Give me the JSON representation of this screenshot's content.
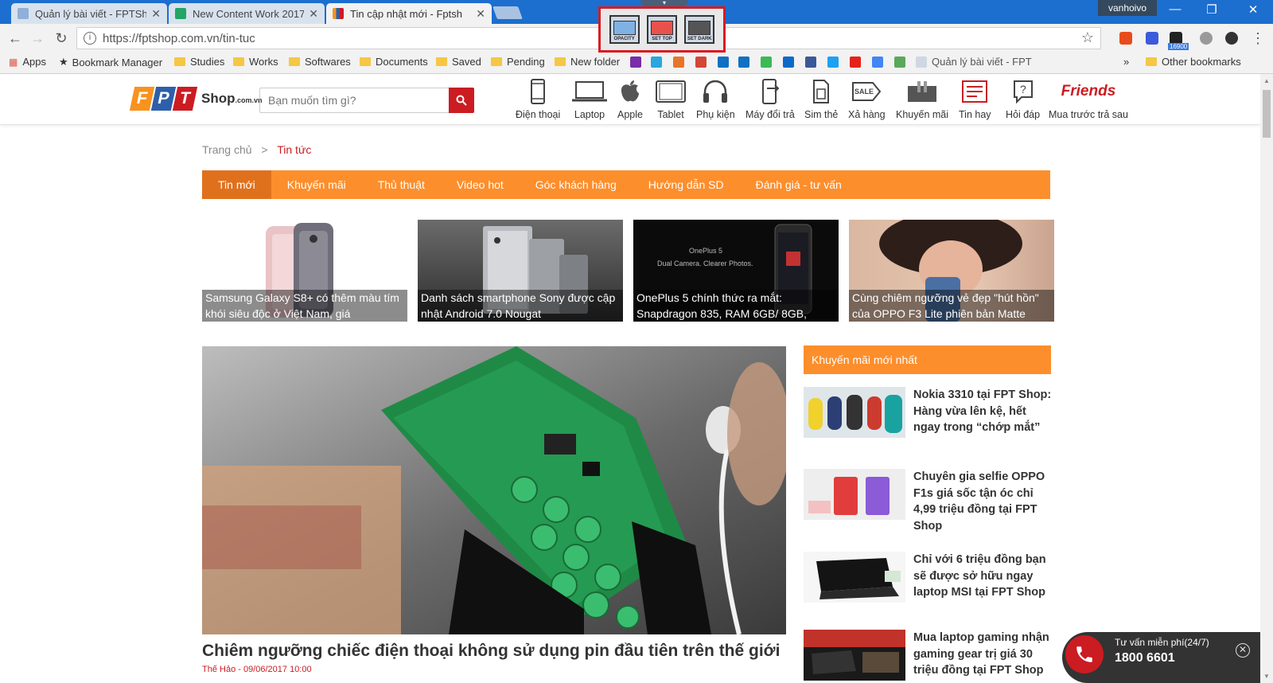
{
  "browser": {
    "tabs": [
      {
        "title": "Quản lý bài viết - FPTSho"
      },
      {
        "title": "New Content Work 2017"
      },
      {
        "title": "Tin cập nhật mới - Fptsh"
      }
    ],
    "user": "vanhoivo",
    "url": "https://fptshop.com.vn/tin-tuc",
    "extension_buttons": [
      "OPACITY",
      "SET TOP",
      "SET DARK"
    ],
    "extension_badge": "16900",
    "bookmarks": [
      "Apps",
      "Bookmark Manager",
      "Studies",
      "Works",
      "Softwares",
      "Documents",
      "Saved",
      "Pending",
      "New folder"
    ],
    "bookmark_page": "Quản lý bài viết - FPT",
    "other_bookmarks": "Other bookmarks",
    "overflow": "»"
  },
  "site": {
    "logo_letters": [
      "F",
      "P",
      "T"
    ],
    "logo_shop": "Shop",
    "logo_domain": ".com.vn",
    "search_placeholder": "Bạn muốn tìm gì?",
    "categories": [
      "Điện thoại",
      "Laptop",
      "Apple",
      "Tablet",
      "Phụ kiện",
      "Máy đổi trả",
      "Sim thẻ",
      "Xả hàng",
      "Khuyến mãi",
      "Tin hay",
      "Hỏi đáp",
      "Mua trước trả sau"
    ],
    "friends_logo": "Friends",
    "sale_label": "SALE",
    "breadcrumb": {
      "home": "Trang chủ",
      "sep": ">",
      "current": "Tin tức"
    },
    "nav": [
      "Tin mới",
      "Khuyến mãi",
      "Thủ thuật",
      "Video hot",
      "Góc khách hàng",
      "Hướng dẫn SD",
      "Đánh giá - tư vấn"
    ],
    "featured": [
      {
        "title": "Samsung Galaxy S8+ có thêm màu tím khói siêu độc ở Việt Nam, giá"
      },
      {
        "title": "Danh sách smartphone Sony được cập nhật Android 7.0 Nougat"
      },
      {
        "title": "OnePlus 5 chính thức ra mắt: Snapdragon 835, RAM 6GB/ 8GB,"
      },
      {
        "title": "Cùng chiêm ngưỡng vẻ đẹp \"hút hồn\" của OPPO F3 Lite phiên bản Matte"
      }
    ],
    "oneplus_promo": [
      "OnePlus 5",
      "Dual Camera. Clearer Photos."
    ],
    "hero": {
      "title": "Chiêm ngưỡng chiếc điện thoại không sử dụng pin đầu tiên trên thế giới",
      "meta": "Thế Hảo - 09/06/2017 10:00"
    },
    "sidebar": {
      "heading": "Khuyến mãi mới nhất",
      "items": [
        {
          "title": "Nokia 3310 tại FPT Shop: Hàng vừa lên kệ, hết ngay trong “chớp mắt”"
        },
        {
          "title": "Chuyên gia selfie OPPO F1s giá sốc tận óc chỉ 4,99 triệu đồng tại FPT Shop"
        },
        {
          "title": "Chỉ với 6 triệu đồng bạn sẽ được sở hữu ngay laptop MSI tại FPT Shop"
        },
        {
          "title": "Mua laptop gaming nhận gaming gear trị giá 30 triệu đồng tại FPT Shop"
        }
      ]
    },
    "hotline": {
      "label": "Tư vấn miễn phí(24/7)",
      "number": "1800 6601"
    }
  },
  "colors": {
    "brand_red": "#cb1c22",
    "nav_orange": "#fd8e2c",
    "nav_active": "#e0711c",
    "chrome_blue": "#1c6ecf"
  }
}
